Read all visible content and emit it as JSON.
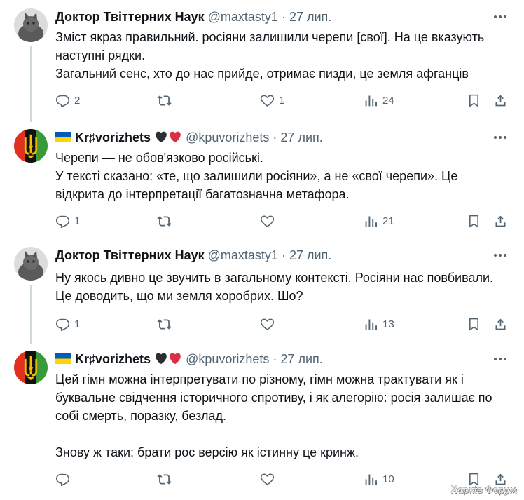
{
  "tweets": [
    {
      "name": "Доктор Твіттерних Наук",
      "handle": "@maxtasty1",
      "dot": "·",
      "date": "27 лип.",
      "avatar": "cat-avatar",
      "flag": false,
      "lines": [
        "Зміст якраз правильний. росіяни залишили черепи [свої]. На це вказують наступні рядки.",
        "Загальний сенс, хто до нас прийде, отримає пизди, це земля афганців"
      ],
      "replies": "2",
      "retweets": "",
      "likes": "1",
      "views": "24"
    },
    {
      "name": "Kr♯vorizhets",
      "handle": "@kpuvorizhets",
      "dot": "·",
      "date": "27 лип.",
      "avatar": "trident-avatar",
      "flag": true,
      "lines": [
        "Черепи — не обов'язково російські.",
        "У тексті сказано: «те, що залишили росіяни», а не «свої черепи». Це відкрита до інтерпретації багатозначна метафора."
      ],
      "replies": "1",
      "retweets": "",
      "likes": "",
      "views": "21"
    },
    {
      "name": "Доктор Твіттерних Наук",
      "handle": "@maxtasty1",
      "dot": "·",
      "date": "27 лип.",
      "avatar": "cat-avatar",
      "flag": false,
      "lines": [
        "Ну якось дивно це звучить в загальному контексті. Росіяни нас повбивали. Це доводить, що ми земля хоробрих. Шо?"
      ],
      "replies": "1",
      "retweets": "",
      "likes": "",
      "views": "13"
    },
    {
      "name": "Kr♯vorizhets",
      "handle": "@kpuvorizhets",
      "dot": "·",
      "date": "27 лип.",
      "avatar": "trident-avatar",
      "flag": true,
      "lines": [
        "Цей гімн можна інтерпретувати по різному, гімн можна трактувати як і буквальне свідчення історичного спротиву, і як алегорію: росія залишає по собі смерть, поразку, безлад.",
        "",
        "Знову ж таки: брати рос версію як істинну це кринж."
      ],
      "replies": "",
      "retweets": "",
      "likes": "",
      "views": "10"
    }
  ],
  "watermark": "Харків Форум",
  "colors": {
    "text": "#0f1419",
    "muted": "#536471",
    "thread": "#cfd9de",
    "heart": "#f91880",
    "black_heart": "#292f33"
  },
  "icons": [
    "reply-icon",
    "retweet-icon",
    "like-icon",
    "views-icon",
    "bookmark-icon",
    "share-icon",
    "more-icon"
  ]
}
